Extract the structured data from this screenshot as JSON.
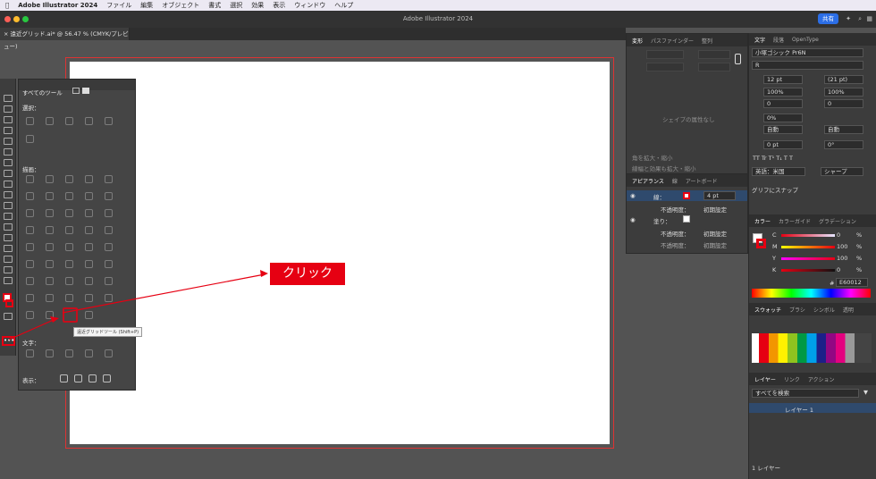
{
  "menubar": {
    "app": "Adobe Illustrator 2024",
    "items": [
      "ファイル",
      "編集",
      "オブジェクト",
      "書式",
      "選択",
      "効果",
      "表示",
      "ウィンドウ",
      "ヘルプ"
    ]
  },
  "window": {
    "title": "Adobe Illustrator 2024",
    "share": "共有"
  },
  "document_tab": "遠近グリッド.ai* @ 56.47 % (CMYK/プレビュー)",
  "tools_panel": {
    "title": "すべてのツール",
    "select": "選択：",
    "draw": "描画：",
    "type": "文字：",
    "display": "表示："
  },
  "tooltip": "遠近グリッドツール (Shift+P)",
  "callout": "クリック",
  "transform_panel": {
    "tabs": [
      "変形",
      "パスファインダー",
      "整列"
    ],
    "empty": "シェイプの属性なし",
    "opt1": "角を拡大・縮小",
    "opt2": "線幅と効果も拡大・縮小"
  },
  "appearance_panel": {
    "tabs": [
      "アピアランス",
      "線",
      "アートボード"
    ],
    "stroke": "線：",
    "stroke_size": "4 pt",
    "opacity": "不透明度：",
    "default": "初期設定",
    "fill": "塗り："
  },
  "character_panel": {
    "tabs": [
      "文字",
      "段落",
      "OpenType"
    ],
    "font": "小塚ゴシック Pr6N",
    "style": "R",
    "size": "12 pt",
    "leading": "(21 pt)",
    "hscale": "100%",
    "vscale": "100%",
    "kern": "0",
    "track": "0",
    "tsume": "0%",
    "aki1": "自動",
    "aki2": "自動",
    "baseline": "0 pt",
    "rotate": "0°",
    "lang": "英語：米国",
    "aa": "シャープ",
    "snap": "グリフにスナップ"
  },
  "color_panel": {
    "tabs": [
      "カラー",
      "カラーガイド",
      "グラデーション"
    ],
    "labels": [
      "C",
      "M",
      "Y",
      "K"
    ],
    "values": [
      "0",
      "100",
      "100",
      "0"
    ],
    "unit": "%",
    "hex": "E60012"
  },
  "swatches_panel": {
    "tabs": [
      "スウォッチ",
      "ブラシ",
      "シンボル",
      "透明"
    ]
  },
  "layers_panel": {
    "tabs": [
      "レイヤー",
      "リンク",
      "アクション"
    ],
    "search": "すべてを検索",
    "layer": "レイヤー 1",
    "count": "1 レイヤー"
  }
}
